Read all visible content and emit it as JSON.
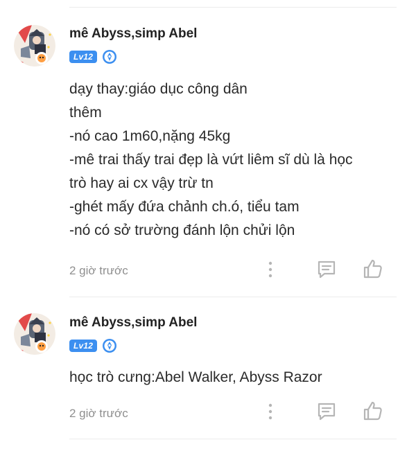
{
  "comments": [
    {
      "username": "mê Abyss,simp Abel",
      "level": "Lv12",
      "lines": [
        "dạy thay:giáo dục công dân",
        "thêm",
        "-nó cao 1m60,nặng 45kg",
        "-mê trai thấy trai đẹp là vứt liêm sĩ dù là học",
        "trò hay ai cx vậy trừ tn",
        "-ghét mấy đứa chảnh ch.ó, tiểu tam",
        "-nó có sở trường đánh lộn chửi lộn"
      ],
      "time": "2 giờ trước",
      "icons": [
        "avatar-image",
        "level-badge",
        "rank-badge-icon",
        "more-options-icon",
        "reply-icon",
        "like-icon"
      ]
    },
    {
      "username": "mê Abyss,simp Abel",
      "level": "Lv12",
      "lines": [
        "học trò cưng:Abel Walker, Abyss Razor"
      ],
      "time": "2 giờ trước",
      "icons": [
        "avatar-image",
        "level-badge",
        "rank-badge-icon",
        "more-options-icon",
        "reply-icon",
        "like-icon"
      ]
    }
  ],
  "colors": {
    "level_badge": "#3c8ff0",
    "time_text": "#8f8f8f",
    "icon": "#b5b5b5",
    "divider": "#ececec"
  }
}
